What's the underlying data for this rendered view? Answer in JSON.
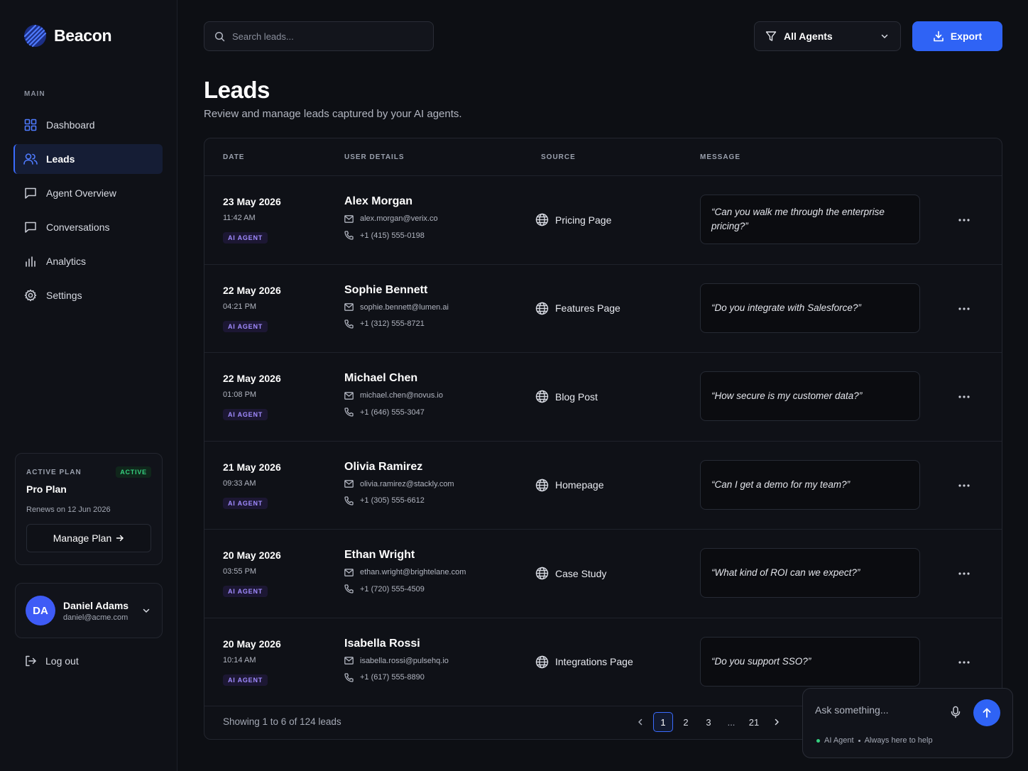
{
  "brand": {
    "name": "Beacon"
  },
  "sidebar": {
    "section_label": "MAIN",
    "items": [
      {
        "label": "Dashboard",
        "icon": "grid-icon"
      },
      {
        "label": "Leads",
        "icon": "users-icon",
        "active": true
      },
      {
        "label": "Agent Overview",
        "icon": "chat-bubble-icon"
      },
      {
        "label": "Conversations",
        "icon": "chat-bubble-icon"
      },
      {
        "label": "Analytics",
        "icon": "bar-chart-icon"
      },
      {
        "label": "Settings",
        "icon": "gear-icon"
      }
    ],
    "plan": {
      "label": "ACTIVE PLAN",
      "badge": "ACTIVE",
      "name": "Pro Plan",
      "renews": "Renews on 12 Jun 2026",
      "button": "Manage Plan"
    },
    "user": {
      "initials": "DA",
      "name": "Daniel Adams",
      "email": "daniel@acme.com"
    },
    "logout": "Log out"
  },
  "topbar": {
    "search_placeholder": "Search leads...",
    "filter_label": "All Agents",
    "export_label": "Export"
  },
  "page": {
    "title": "Leads",
    "subtitle": "Review and manage leads captured by your AI agents."
  },
  "table": {
    "headers": {
      "date": "DATE",
      "user": "USER DETAILS",
      "source": "SOURCE",
      "message": "MESSAGE"
    },
    "rows": [
      {
        "date": "23 May 2026",
        "time": "11:42 AM",
        "badge": "AI AGENT",
        "name": "Alex Morgan",
        "email": "alex.morgan@verix.co",
        "phone": "+1 (415) 555-0198",
        "source": "Pricing Page",
        "message": "“Can you walk me through the enterprise pricing?”"
      },
      {
        "date": "22 May 2026",
        "time": "04:21 PM",
        "badge": "AI AGENT",
        "name": "Sophie Bennett",
        "email": "sophie.bennett@lumen.ai",
        "phone": "+1 (312) 555-8721",
        "source": "Features Page",
        "message": "“Do you integrate with Salesforce?”"
      },
      {
        "date": "22 May 2026",
        "time": "01:08 PM",
        "badge": "AI AGENT",
        "name": "Michael Chen",
        "email": "michael.chen@novus.io",
        "phone": "+1 (646) 555-3047",
        "source": "Blog Post",
        "message": "“How secure is my customer data?”"
      },
      {
        "date": "21 May 2026",
        "time": "09:33 AM",
        "badge": "AI AGENT",
        "name": "Olivia Ramirez",
        "email": "olivia.ramirez@stackly.com",
        "phone": "+1 (305) 555-6612",
        "source": "Homepage",
        "message": "“Can I get a demo for my team?”"
      },
      {
        "date": "20 May 2026",
        "time": "03:55 PM",
        "badge": "AI AGENT",
        "name": "Ethan Wright",
        "email": "ethan.wright@brightelane.com",
        "phone": "+1 (720) 555-4509",
        "source": "Case Study",
        "message": "“What kind of ROI can we expect?”"
      },
      {
        "date": "20 May 2026",
        "time": "10:14 AM",
        "badge": "AI AGENT",
        "name": "Isabella Rossi",
        "email": "isabella.rossi@pulsehq.io",
        "phone": "+1 (617) 555-8890",
        "source": "Integrations Page",
        "message": "“Do you support SSO?”"
      }
    ],
    "footer": {
      "showing": "Showing 1 to 6 of 124 leads",
      "pages": [
        "1",
        "2",
        "3",
        "...",
        "21"
      ],
      "current_page": "1"
    }
  },
  "chat": {
    "placeholder": "Ask something...",
    "status_agent": "AI Agent",
    "status_text": "Always here to help"
  },
  "colors": {
    "accent": "#2f63f5",
    "background": "#0d0f14",
    "active_green": "#35d07f",
    "ai_badge_purple": "#a18bff"
  }
}
